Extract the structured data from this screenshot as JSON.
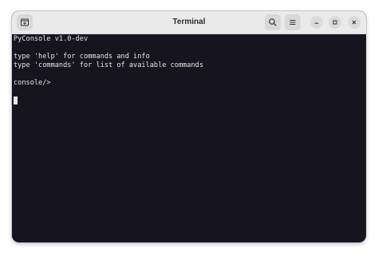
{
  "window": {
    "title": "Terminal"
  },
  "icons": {
    "new_tab": "new-tab-icon",
    "search": "search-icon",
    "menu": "hamburger-menu-icon",
    "minimize": "minimize-icon",
    "maximize": "maximize-icon",
    "close": "close-icon"
  },
  "terminal": {
    "lines": [
      "PyConsole v1.0-dev",
      "",
      "type 'help' for commands and info",
      "type 'commands' for list of available commands",
      "",
      "console/>"
    ]
  },
  "colors": {
    "terminal_bg": "#16151f",
    "terminal_fg": "#e6e6e6",
    "titlebar_bg": "#eaeaea"
  }
}
